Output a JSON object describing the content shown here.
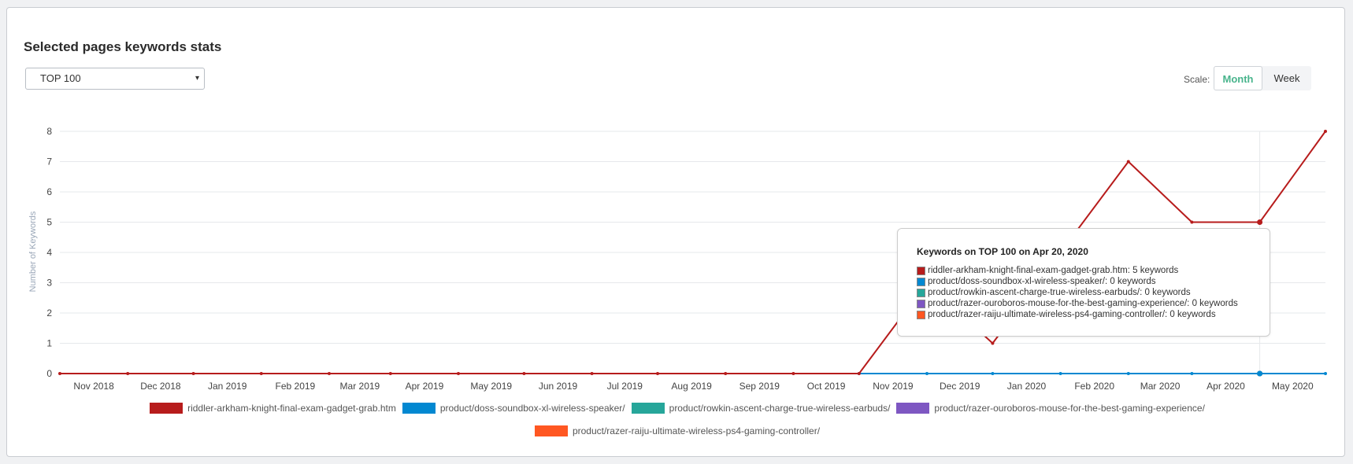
{
  "panel": {
    "title": "Selected pages keywords stats",
    "select": {
      "value": "TOP 100",
      "arrow": "▾"
    },
    "scale": {
      "label": "Scale:",
      "options": [
        "Month",
        "Week"
      ],
      "active": "Month"
    }
  },
  "chart_data": {
    "type": "line",
    "ylabel": "Number of Keywords",
    "xlabel": "",
    "ylim": [
      0,
      8
    ],
    "yticks": [
      0,
      1,
      2,
      3,
      4,
      5,
      6,
      7,
      8
    ],
    "grid": true,
    "legend_position": "bottom",
    "x_tick_labels": [
      "Nov 2018",
      "Dec 2018",
      "Jan 2019",
      "Feb 2019",
      "Mar 2019",
      "Apr 2019",
      "May 2019",
      "Jun 2019",
      "Jul 2019",
      "Aug 2019",
      "Sep 2019",
      "Oct 2019",
      "Nov 2019",
      "Dec 2019",
      "Jan 2020",
      "Feb 2020",
      "Mar 2020",
      "Apr 2020",
      "May 2020"
    ],
    "x": [
      "2018-10-20",
      "2018-11-20",
      "2018-12-20",
      "2019-01-20",
      "2019-02-20",
      "2019-03-20",
      "2019-04-20",
      "2019-05-20",
      "2019-06-20",
      "2019-07-20",
      "2019-08-20",
      "2019-09-20",
      "2019-10-20",
      "2019-11-20",
      "2019-12-20",
      "2020-01-20",
      "2020-02-20",
      "2020-03-20",
      "2020-04-20",
      "2020-05-20"
    ],
    "series": [
      {
        "name": "riddler-arkham-knight-final-exam-gadget-grab.htm",
        "color": "#b71c1c",
        "values": [
          0,
          0,
          0,
          0,
          0,
          0,
          0,
          0,
          0,
          0,
          0,
          0,
          0,
          3,
          1,
          4,
          7,
          5,
          5,
          8
        ]
      },
      {
        "name": "product/doss-soundbox-xl-wireless-speaker/",
        "color": "#0288d1",
        "values": [
          null,
          null,
          null,
          null,
          null,
          null,
          null,
          null,
          null,
          null,
          null,
          null,
          0,
          0,
          0,
          0,
          0,
          0,
          0,
          0
        ]
      },
      {
        "name": "product/rowkin-ascent-charge-true-wireless-earbuds/",
        "color": "#26a69a",
        "values": [
          null,
          null,
          null,
          null,
          null,
          null,
          null,
          null,
          null,
          null,
          null,
          null,
          null,
          null,
          null,
          null,
          null,
          null,
          0,
          null
        ]
      },
      {
        "name": "product/razer-ouroboros-mouse-for-the-best-gaming-experience/",
        "color": "#7e57c2",
        "values": [
          null,
          null,
          null,
          null,
          null,
          null,
          null,
          null,
          null,
          null,
          null,
          null,
          null,
          null,
          null,
          null,
          null,
          null,
          0,
          null
        ]
      },
      {
        "name": "product/razer-raiju-ultimate-wireless-ps4-gaming-controller/",
        "color": "#ff5722",
        "values": [
          null,
          null,
          null,
          null,
          null,
          null,
          null,
          null,
          null,
          null,
          null,
          null,
          null,
          null,
          null,
          null,
          null,
          null,
          0,
          null
        ]
      }
    ],
    "tooltip": {
      "title": "Keywords on TOP 100 on Apr 20, 2020",
      "rows": [
        "riddler-arkham-knight-final-exam-gadget-grab.htm: 5 keywords",
        "product/doss-soundbox-xl-wireless-speaker/: 0 keywords",
        "product/rowkin-ascent-charge-true-wireless-earbuds/: 0 keywords",
        "product/razer-ouroboros-mouse-for-the-best-gaming-experience/: 0 keywords",
        "product/razer-raiju-ultimate-wireless-ps4-gaming-controller/: 0 keywords"
      ]
    }
  }
}
